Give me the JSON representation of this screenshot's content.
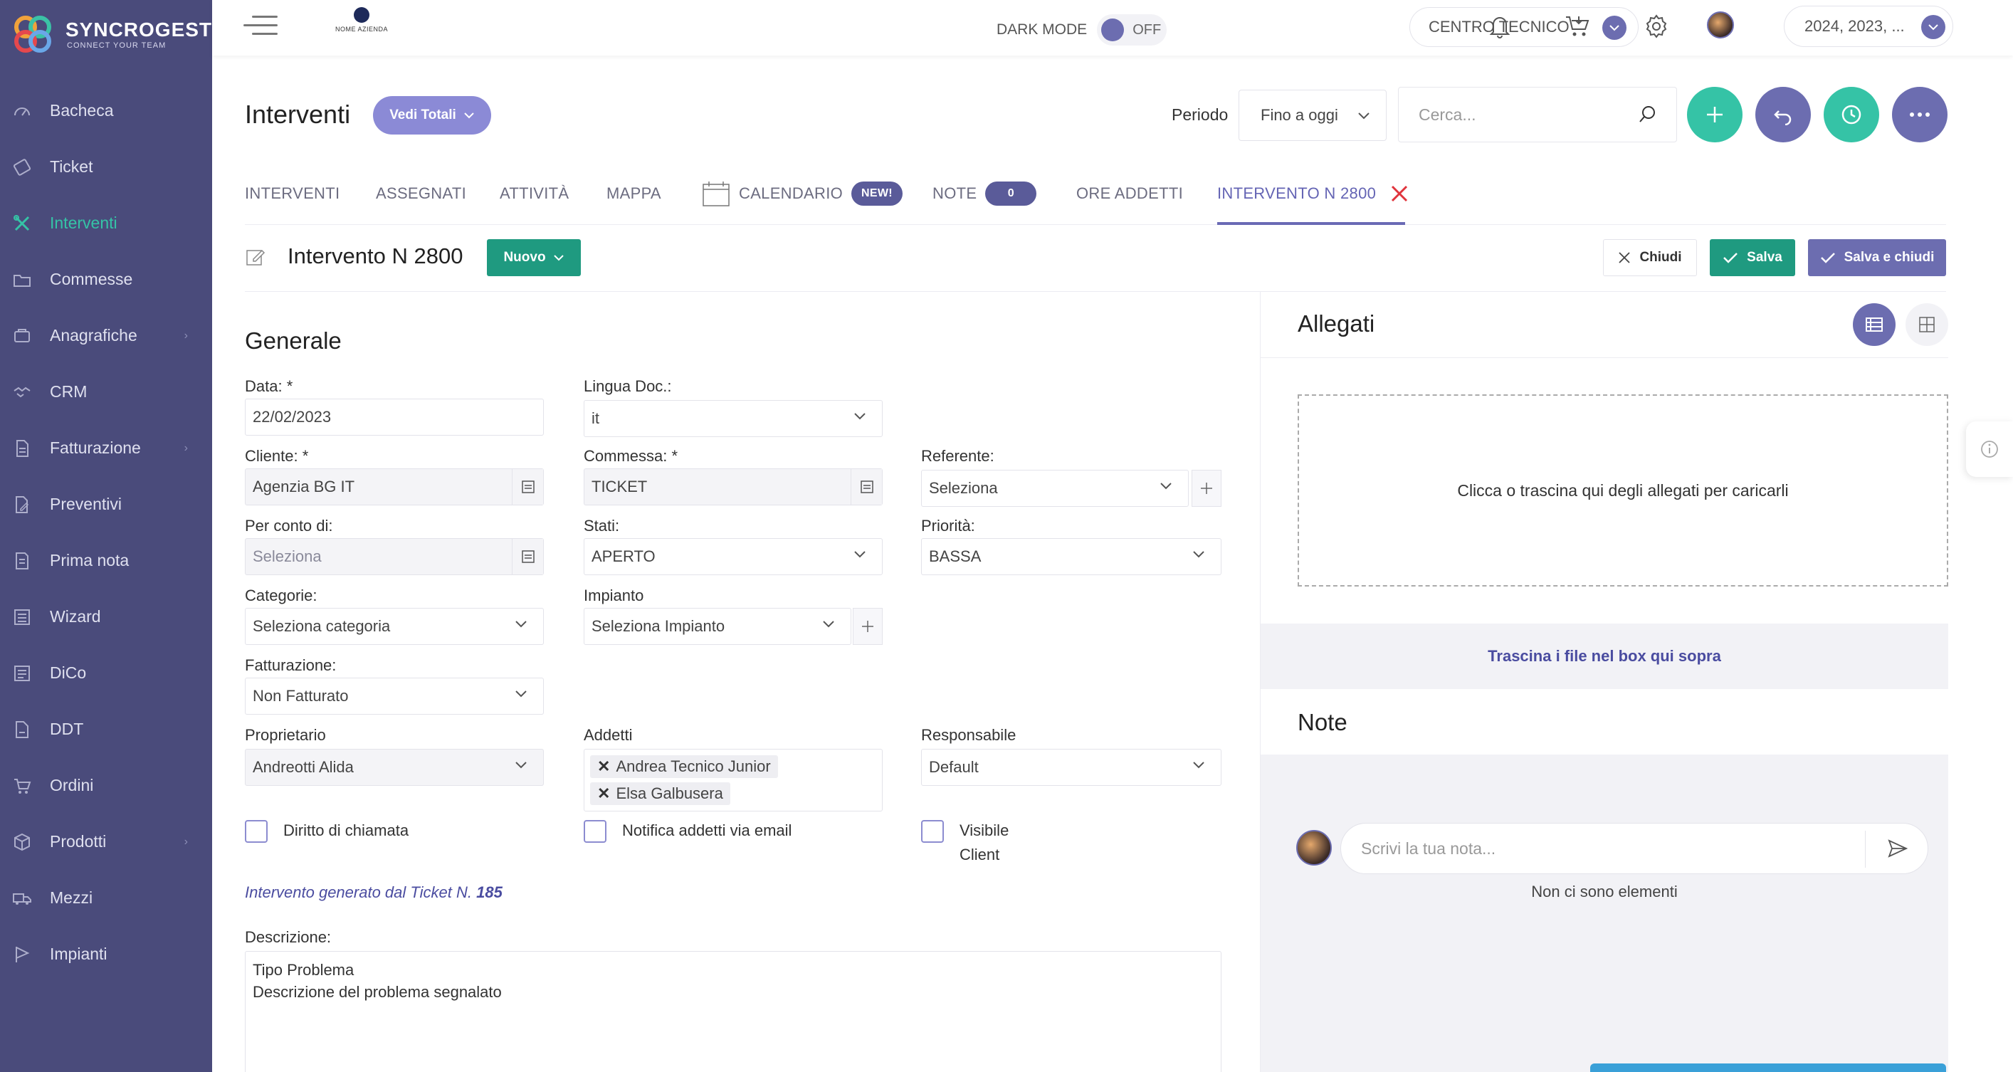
{
  "brand": {
    "name": "SYNCROGEST",
    "tagline": "CONNECT YOUR TEAM",
    "company_logo_label": "NOME AZIENDA"
  },
  "sidebar": {
    "items": [
      {
        "label": "Bacheca",
        "icon": "dashboard-icon"
      },
      {
        "label": "Ticket",
        "icon": "ticket-icon"
      },
      {
        "label": "Interventi",
        "icon": "tools-icon",
        "active": true
      },
      {
        "label": "Commesse",
        "icon": "folder-icon"
      },
      {
        "label": "Anagrafiche",
        "icon": "contacts-icon",
        "has_children": true
      },
      {
        "label": "CRM",
        "icon": "handshake-icon"
      },
      {
        "label": "Fatturazione",
        "icon": "invoice-icon",
        "has_children": true
      },
      {
        "label": "Preventivi",
        "icon": "quote-icon"
      },
      {
        "label": "Prima nota",
        "icon": "ledger-icon"
      },
      {
        "label": "Wizard",
        "icon": "wizard-icon"
      },
      {
        "label": "DiCo",
        "icon": "document-icon"
      },
      {
        "label": "DDT",
        "icon": "ddt-icon"
      },
      {
        "label": "Ordini",
        "icon": "cart-icon"
      },
      {
        "label": "Prodotti",
        "icon": "box-icon",
        "has_children": true
      },
      {
        "label": "Mezzi",
        "icon": "truck-icon"
      },
      {
        "label": "Impianti",
        "icon": "flag-icon"
      }
    ]
  },
  "topbar": {
    "dark_mode_label": "DARK MODE",
    "dark_mode_state": "OFF",
    "center": "CENTRO TECNICO",
    "years": "2024, 2023, ..."
  },
  "page": {
    "title": "Interventi",
    "totals_button": "Vedi Totali",
    "periodo_label": "Periodo",
    "periodo_value": "Fino a oggi",
    "search_placeholder": "Cerca..."
  },
  "tabs": [
    {
      "label": "INTERVENTI"
    },
    {
      "label": "ASSEGNATI"
    },
    {
      "label": "ATTIVITÀ"
    },
    {
      "label": "MAPPA"
    },
    {
      "label": "CALENDARIO",
      "badge": "NEW!"
    },
    {
      "label": "NOTE",
      "badge": "0"
    },
    {
      "label": "ORE ADDETTI"
    },
    {
      "label": "INTERVENTO N 2800",
      "active": true
    }
  ],
  "form_header": {
    "title": "Intervento N 2800",
    "status_button": "Nuovo",
    "close_button": "Chiudi",
    "save_button": "Salva",
    "save_close_button": "Salva e chiudi"
  },
  "form": {
    "section_title": "Generale",
    "data": {
      "label": "Data: *",
      "value": "22/02/2023"
    },
    "lingua": {
      "label": "Lingua Doc.:",
      "value": "it"
    },
    "cliente": {
      "label": "Cliente: *",
      "value": "Agenzia BG IT"
    },
    "commessa": {
      "label": "Commessa: *",
      "value": "TICKET"
    },
    "referente": {
      "label": "Referente:",
      "value": "Seleziona"
    },
    "per_conto": {
      "label": "Per conto di:",
      "value": "Seleziona"
    },
    "stati": {
      "label": "Stati:",
      "value": "APERTO"
    },
    "priorita": {
      "label": "Priorità:",
      "value": "BASSA"
    },
    "categorie": {
      "label": "Categorie:",
      "value": "Seleziona categoria"
    },
    "impianto": {
      "label": "Impianto",
      "value": "Seleziona Impianto"
    },
    "fatturazione": {
      "label": "Fatturazione:",
      "value": "Non Fatturato"
    },
    "proprietario": {
      "label": "Proprietario",
      "value": "Andreotti Alida"
    },
    "addetti": {
      "label": "Addetti",
      "tags": [
        "Andrea Tecnico Junior",
        "Elsa Galbusera"
      ]
    },
    "responsabile": {
      "label": "Responsabile",
      "value": "Default"
    },
    "checkboxes": {
      "diritto": "Diritto di chiamata",
      "notifica": "Notifica addetti via email",
      "visibile_1": "Visibile",
      "visibile_2": "Client"
    },
    "generated_note": "Intervento generato dal Ticket N.",
    "generated_ticket": "185",
    "descrizione_label": "Descrizione:",
    "descrizione_value": "Tipo Problema\nDescrizione del problema segnalato"
  },
  "allegati": {
    "title": "Allegati",
    "dropzone_text": "Clicca o trascina qui degli allegati per caricarli",
    "drop_hint": "Trascina i file nel box qui sopra"
  },
  "note": {
    "title": "Note",
    "empty_text": "Non ci sono elementi",
    "input_placeholder": "Scrivi la tua nota..."
  },
  "colors": {
    "sidebar": "#4a4b7b",
    "accent_green": "#35c3a6",
    "accent_purple": "#6c6db0",
    "teal_button": "#1f9a80"
  }
}
